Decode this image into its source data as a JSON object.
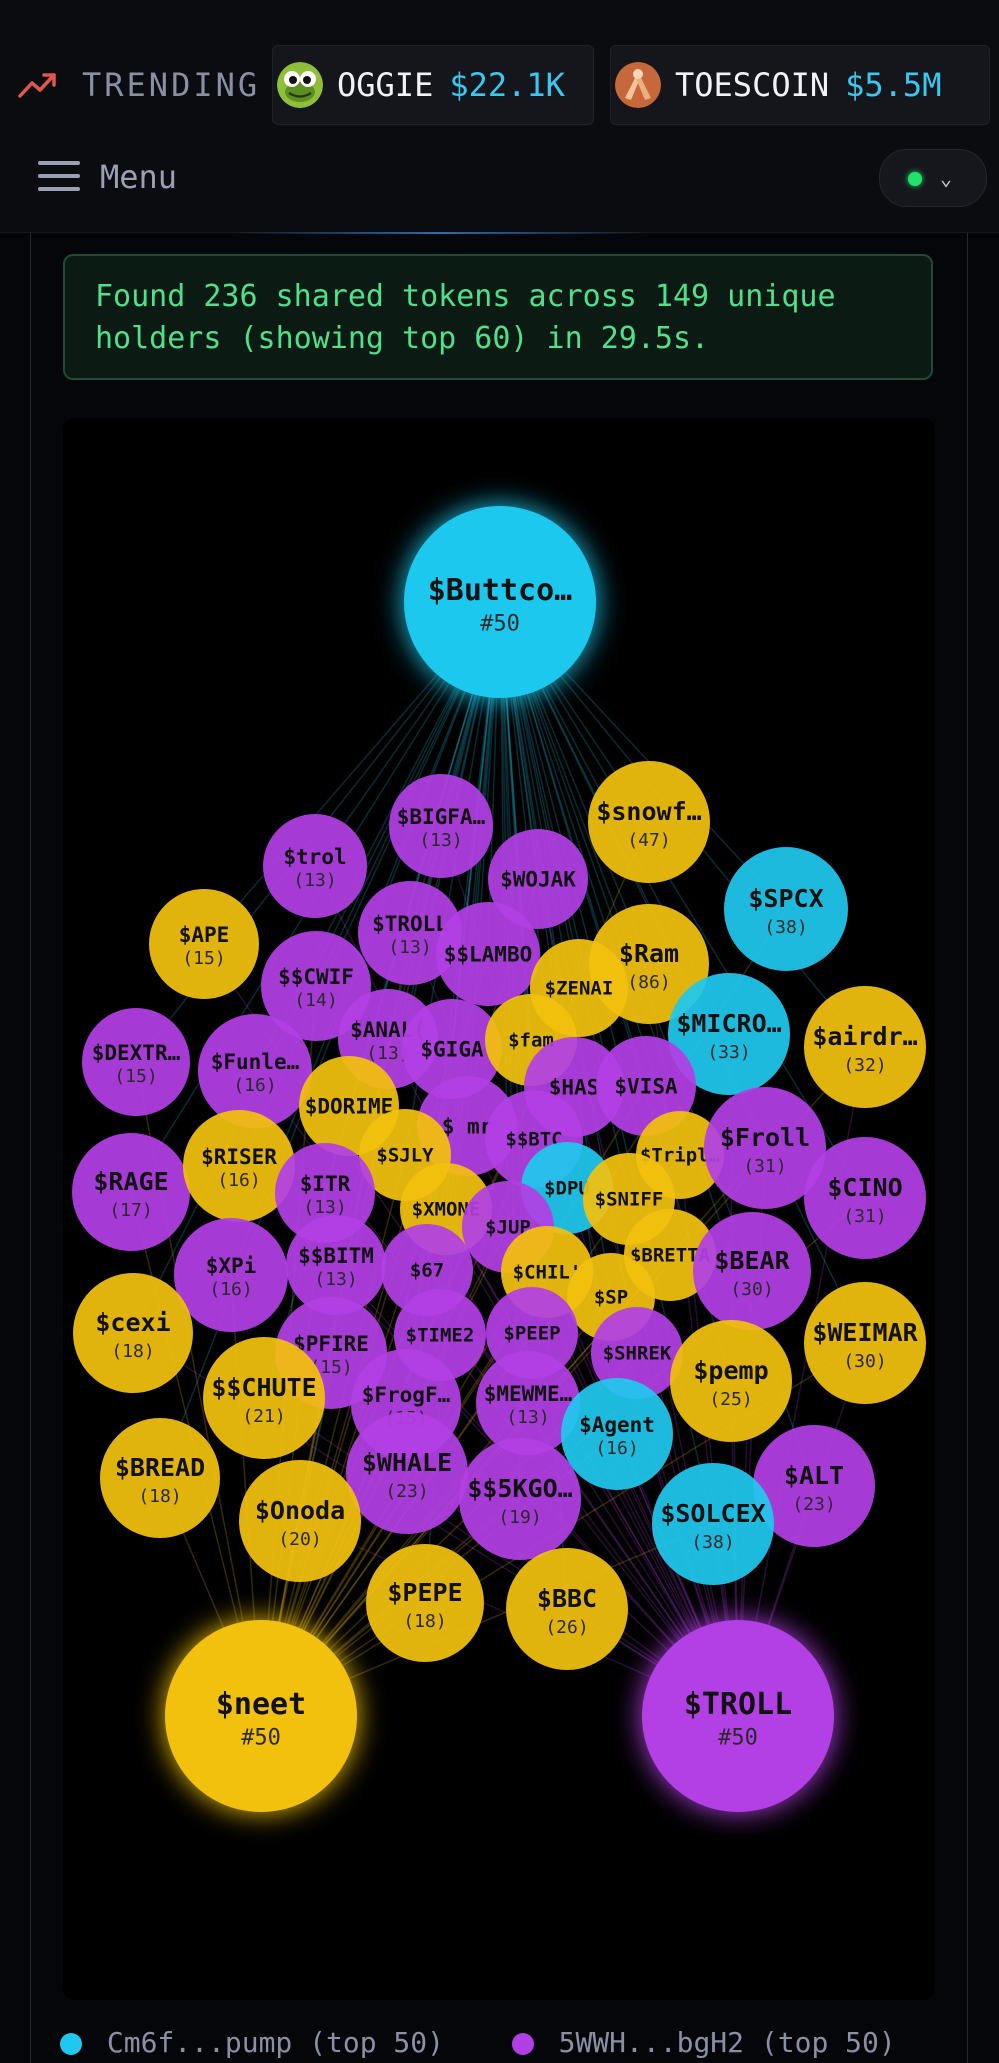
{
  "trending": {
    "label": "TRENDING",
    "items": [
      {
        "symbol": "OGGIE",
        "price": "$22.1K"
      },
      {
        "symbol": "TOESCOIN",
        "price": "$5.5M"
      }
    ]
  },
  "menu": {
    "label": "Menu"
  },
  "status": {
    "message": "Found 236 shared tokens across 149 unique holders (showing top 60) in 29.5s."
  },
  "colors": {
    "cyan": "#1fc8ee",
    "purple": "#b23fe4",
    "yellow": "#f2c10e"
  },
  "graph": {
    "anchors": [
      {
        "label": "$Buttco…",
        "sub": "#50",
        "color": "cyan"
      },
      {
        "label": "$neet",
        "sub": "#50",
        "color": "yellow"
      },
      {
        "label": "$TROLL",
        "sub": "#50",
        "color": "purple"
      }
    ],
    "nodes": [
      {
        "label": "$BIGFA…",
        "sub": "(13)",
        "color": "purple"
      },
      {
        "label": "$snowf…",
        "sub": "(47)",
        "color": "yellow"
      },
      {
        "label": "$trol",
        "sub": "(13)",
        "color": "purple"
      },
      {
        "label": "$WOJAK",
        "sub": "",
        "color": "purple"
      },
      {
        "label": "$SPCX",
        "sub": "(38)",
        "color": "cyan"
      },
      {
        "label": "$APE",
        "sub": "(15)",
        "color": "yellow"
      },
      {
        "label": "$TROLL",
        "sub": "(13)",
        "color": "purple"
      },
      {
        "label": "$$LAMBO",
        "sub": "",
        "color": "purple"
      },
      {
        "label": "$Ram",
        "sub": "(86)",
        "color": "yellow"
      },
      {
        "label": "$$CWIF",
        "sub": "(14)",
        "color": "purple"
      },
      {
        "label": "$ZENAI",
        "sub": "",
        "color": "yellow"
      },
      {
        "label": "$MICRO…",
        "sub": "(33)",
        "color": "cyan"
      },
      {
        "label": "$airdr…",
        "sub": "(32)",
        "color": "yellow"
      },
      {
        "label": "$DEXTR…",
        "sub": "(15)",
        "color": "purple"
      },
      {
        "label": "$Funle…",
        "sub": "(16)",
        "color": "purple"
      },
      {
        "label": "$ANAL(",
        "sub": "(13)",
        "color": "purple"
      },
      {
        "label": "$GIGA",
        "sub": "",
        "color": "purple"
      },
      {
        "label": "$fam",
        "sub": "",
        "color": "yellow"
      },
      {
        "label": "$HAS",
        "sub": "",
        "color": "purple"
      },
      {
        "label": "$VISA",
        "sub": "",
        "color": "purple"
      },
      {
        "label": "$DORIME",
        "sub": "",
        "color": "yellow"
      },
      {
        "label": "$ mr",
        "sub": "",
        "color": "purple"
      },
      {
        "label": "$$BTC",
        "sub": "",
        "color": "purple"
      },
      {
        "label": "$Tripl…",
        "sub": "",
        "color": "yellow"
      },
      {
        "label": "$Froll",
        "sub": "(31)",
        "color": "purple"
      },
      {
        "label": "$RAGE",
        "sub": "(17)",
        "color": "purple"
      },
      {
        "label": "$RISER",
        "sub": "(16)",
        "color": "yellow"
      },
      {
        "label": "$SJLY",
        "sub": "",
        "color": "yellow"
      },
      {
        "label": "$ITR",
        "sub": "(13)",
        "color": "purple"
      },
      {
        "label": "$DPU",
        "sub": "",
        "color": "cyan"
      },
      {
        "label": "$SNIFF",
        "sub": "",
        "color": "yellow"
      },
      {
        "label": "$CINO",
        "sub": "(31)",
        "color": "purple"
      },
      {
        "label": "$XMONE",
        "sub": "",
        "color": "yellow"
      },
      {
        "label": "$JUP",
        "sub": "",
        "color": "purple"
      },
      {
        "label": "$XPi",
        "sub": "(16)",
        "color": "purple"
      },
      {
        "label": "$$BITM",
        "sub": "(13)",
        "color": "purple"
      },
      {
        "label": "$67",
        "sub": "",
        "color": "purple"
      },
      {
        "label": "$BRETTA",
        "sub": "",
        "color": "yellow"
      },
      {
        "label": "$BEAR",
        "sub": "(30)",
        "color": "purple"
      },
      {
        "label": "$CHIL'",
        "sub": "",
        "color": "yellow"
      },
      {
        "label": "$SP",
        "sub": "",
        "color": "yellow"
      },
      {
        "label": "$cexi",
        "sub": "(18)",
        "color": "yellow"
      },
      {
        "label": "$WEIMAR",
        "sub": "(30)",
        "color": "yellow"
      },
      {
        "label": "$PFIRE",
        "sub": "(15)",
        "color": "purple"
      },
      {
        "label": "$TIME2",
        "sub": "",
        "color": "purple"
      },
      {
        "label": "$PEEP",
        "sub": "",
        "color": "purple"
      },
      {
        "label": "$SHREK",
        "sub": "",
        "color": "purple"
      },
      {
        "label": "$$CHUTE",
        "sub": "(21)",
        "color": "yellow"
      },
      {
        "label": "$FrogF…",
        "sub": "(15)",
        "color": "purple"
      },
      {
        "label": "$MEWME…",
        "sub": "(13)",
        "color": "purple"
      },
      {
        "label": "$pemp",
        "sub": "(25)",
        "color": "yellow"
      },
      {
        "label": "$Agent",
        "sub": "(16)",
        "color": "cyan"
      },
      {
        "label": "$BREAD",
        "sub": "(18)",
        "color": "yellow"
      },
      {
        "label": "$ALT",
        "sub": "(23)",
        "color": "purple"
      },
      {
        "label": "$WHALE",
        "sub": "(23)",
        "color": "purple"
      },
      {
        "label": "$$5KGO…",
        "sub": "(19)",
        "color": "purple"
      },
      {
        "label": "$Onoda",
        "sub": "(20)",
        "color": "yellow"
      },
      {
        "label": "$SOLCEX",
        "sub": "(38)",
        "color": "cyan"
      },
      {
        "label": "$PEPE",
        "sub": "(18)",
        "color": "yellow"
      },
      {
        "label": "$BBC",
        "sub": "(26)",
        "color": "yellow"
      }
    ]
  },
  "legend": [
    {
      "text": "Cm6f...pump (top 50)",
      "color": "cyan"
    },
    {
      "text": "5WWH...bgH2 (top 50)",
      "color": "purple"
    }
  ]
}
